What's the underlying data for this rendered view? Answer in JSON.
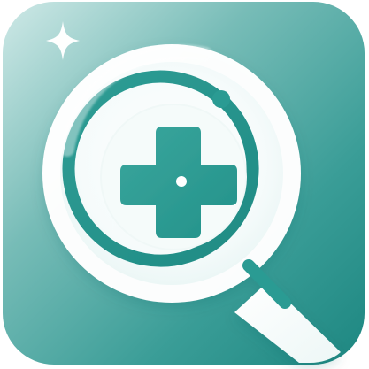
{
  "app_icon": {
    "icon_name": "medical-search-app-icon",
    "shape": "rounded-square",
    "colors": {
      "background_light": "#cfe9e7",
      "background_mid": "#5eb0ab",
      "background_dark": "#1f8c86",
      "lens_ring": "#ffffff",
      "lens_inner": "#eef8f7",
      "accent_teal": "#23958d",
      "accent_teal_light": "#49aaa3",
      "cross": "#2a9c93",
      "sparkle": "#ffffff",
      "handle": "#ffffff"
    },
    "elements": {
      "sparkle": "sparkle-icon",
      "magnifier": "magnifying-glass-icon",
      "cross": "medical-cross-icon",
      "center_dot": "center-dot"
    }
  }
}
